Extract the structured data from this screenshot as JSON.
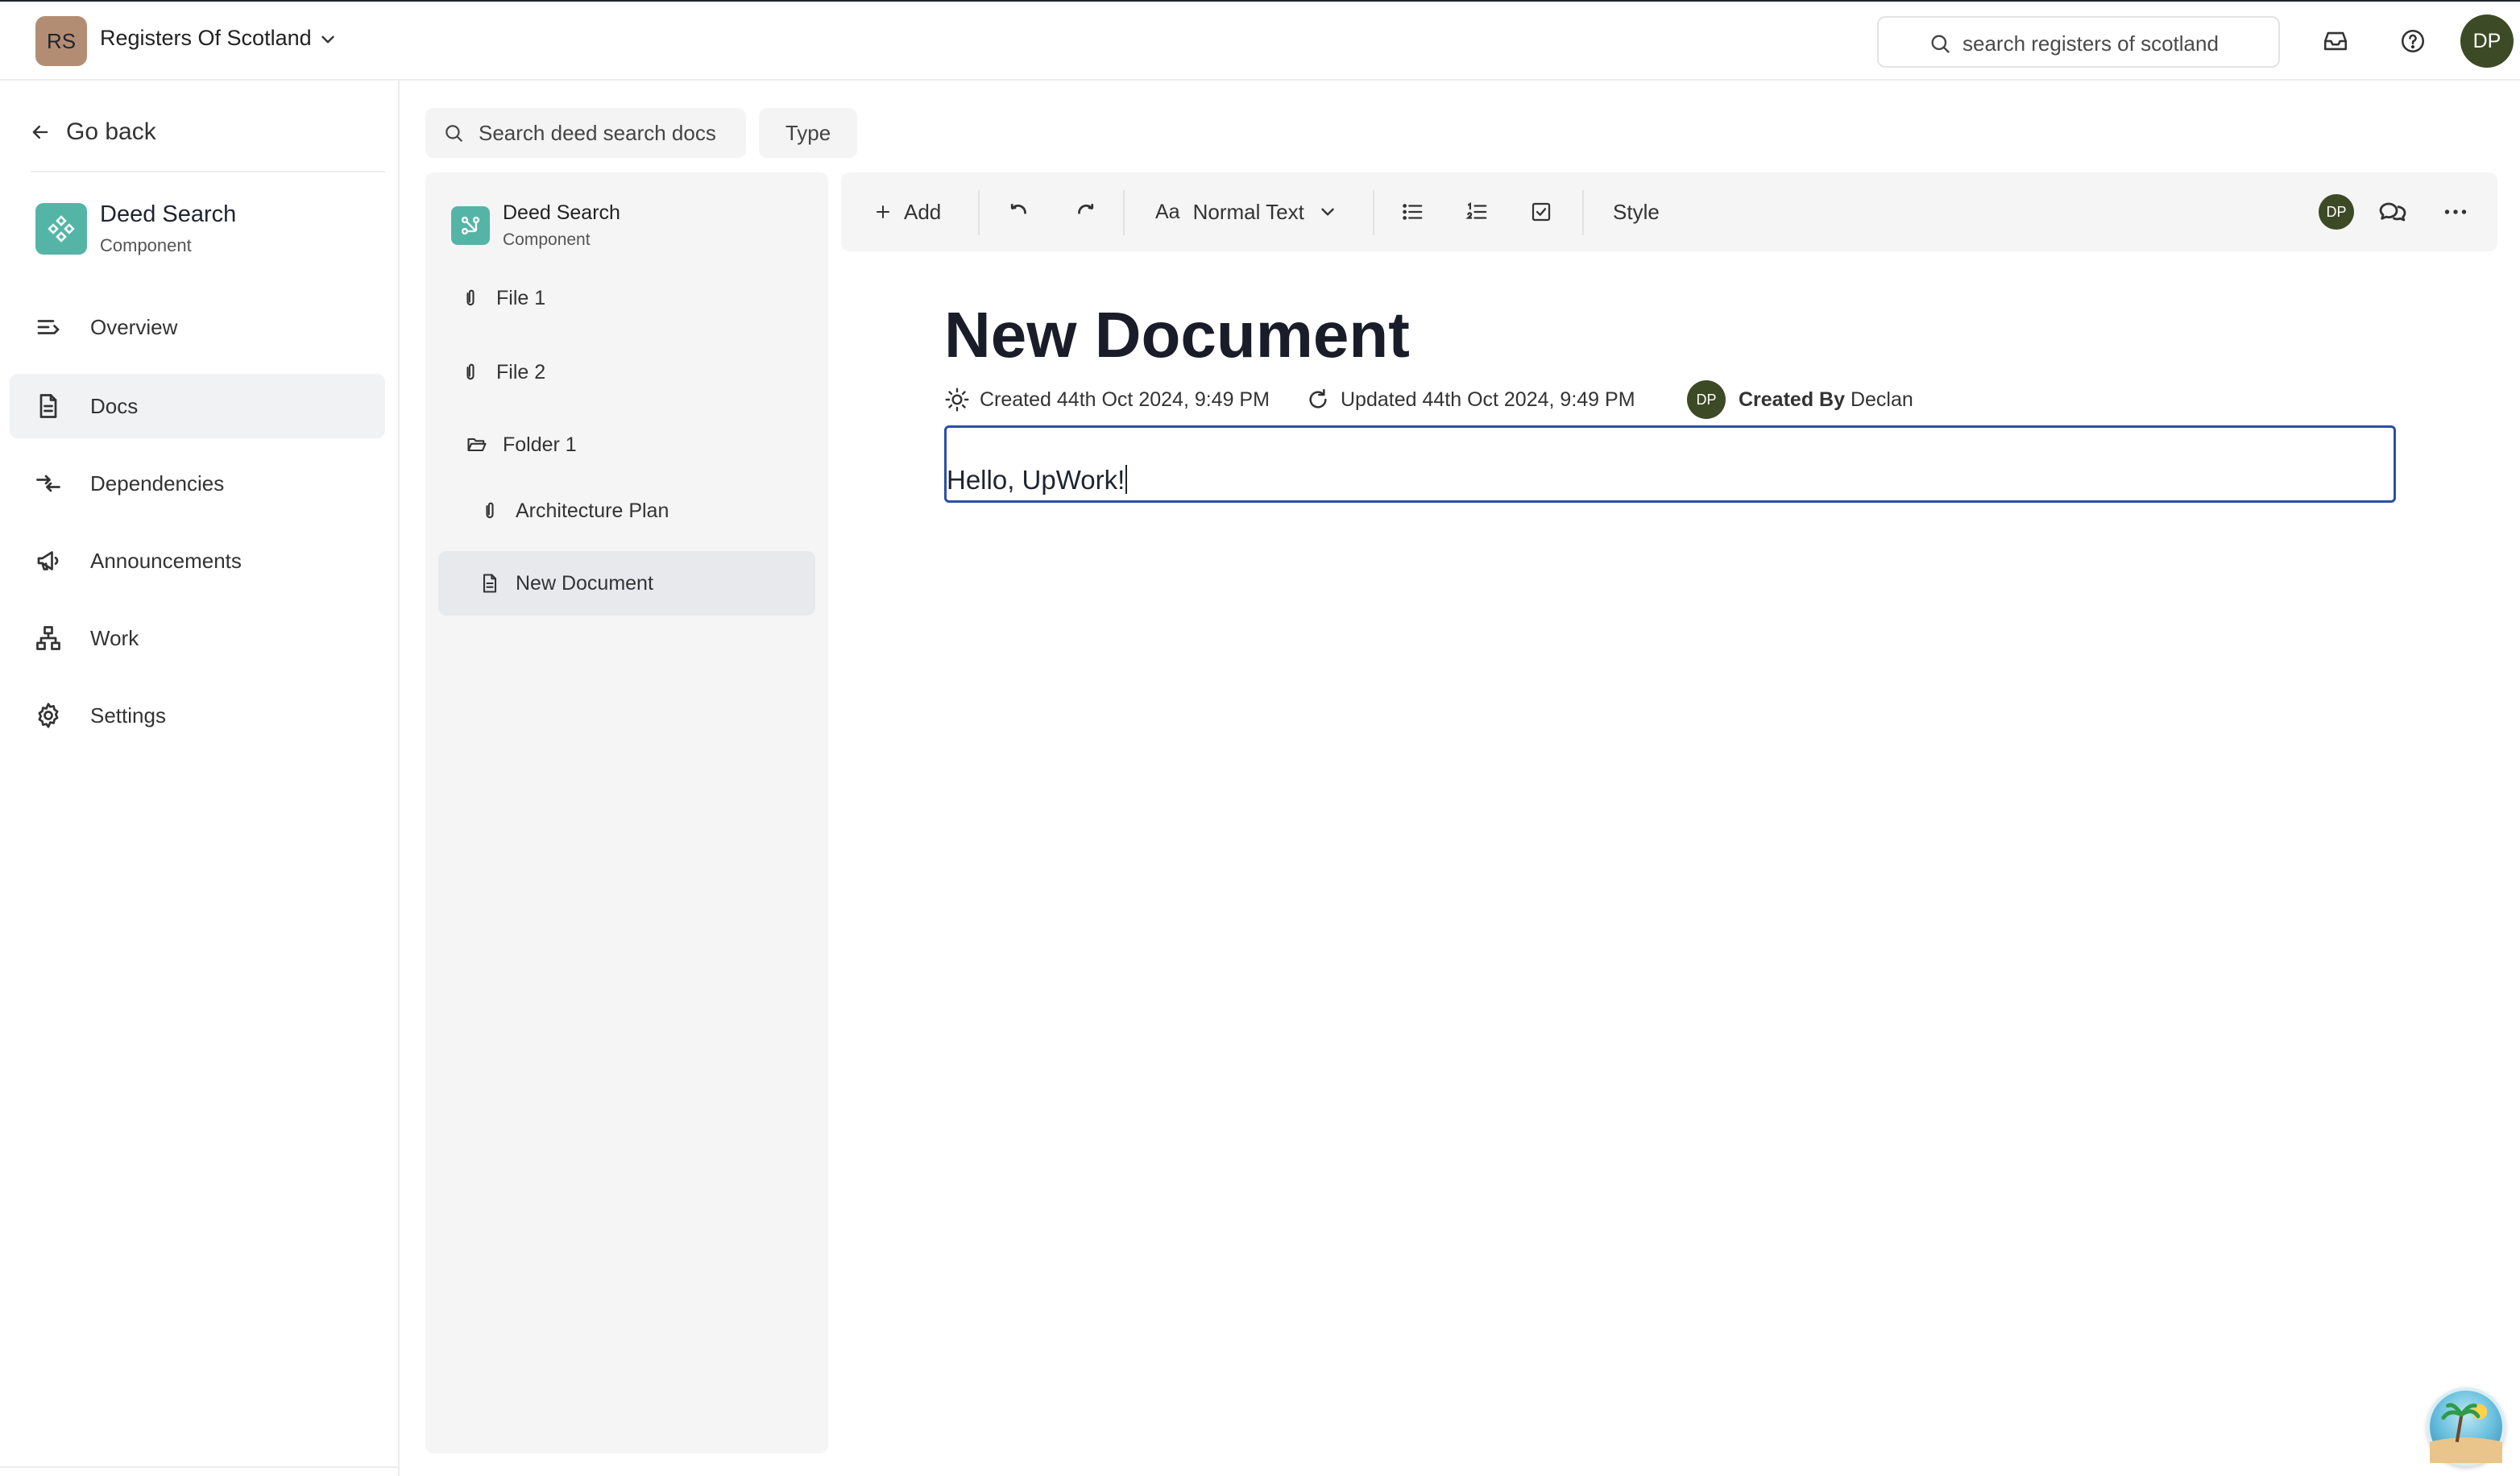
{
  "topbar": {
    "org_initials": "RS",
    "org_name": "Registers Of Scotland",
    "search_placeholder": "search registers of scotland",
    "user_initials": "DP"
  },
  "sidebar": {
    "go_back": "Go back",
    "component": {
      "name": "Deed Search",
      "type": "Component"
    },
    "items": [
      {
        "label": "Overview",
        "icon": "overview-icon",
        "active": false
      },
      {
        "label": "Docs",
        "icon": "document-icon",
        "active": true
      },
      {
        "label": "Dependencies",
        "icon": "dependencies-icon",
        "active": false
      },
      {
        "label": "Announcements",
        "icon": "megaphone-icon",
        "active": false
      },
      {
        "label": "Work",
        "icon": "hierarchy-icon",
        "active": false
      },
      {
        "label": "Settings",
        "icon": "gear-icon",
        "active": false
      }
    ]
  },
  "docs": {
    "search_placeholder": "Search deed search docs",
    "type_filter": "Type",
    "tree": {
      "root": {
        "name": "Deed Search",
        "type": "Component"
      },
      "items": [
        {
          "label": "File 1",
          "icon": "paperclip-icon"
        },
        {
          "label": "File 2",
          "icon": "paperclip-icon"
        },
        {
          "label": "Folder 1",
          "icon": "folder-open-icon"
        },
        {
          "label": "Architecture Plan",
          "icon": "paperclip-icon"
        },
        {
          "label": "New Document",
          "icon": "document-icon",
          "active": true
        }
      ]
    }
  },
  "toolbar": {
    "add": "Add",
    "text_style": "Normal Text",
    "style": "Style",
    "collaborator_initials": "DP"
  },
  "document": {
    "title": "New Document",
    "created": "Created 44th Oct 2024, 9:49 PM",
    "updated": "Updated 44th Oct 2024, 9:49 PM",
    "author_initials": "DP",
    "created_by_label": "Created By",
    "created_by_name": "Declan",
    "body_text": "Hello, UpWork!"
  },
  "colors": {
    "accent_teal": "#54b5a6",
    "org_avatar": "#b38d73",
    "user_avatar": "#3c4a26",
    "focus_border": "#2a4fa8"
  }
}
